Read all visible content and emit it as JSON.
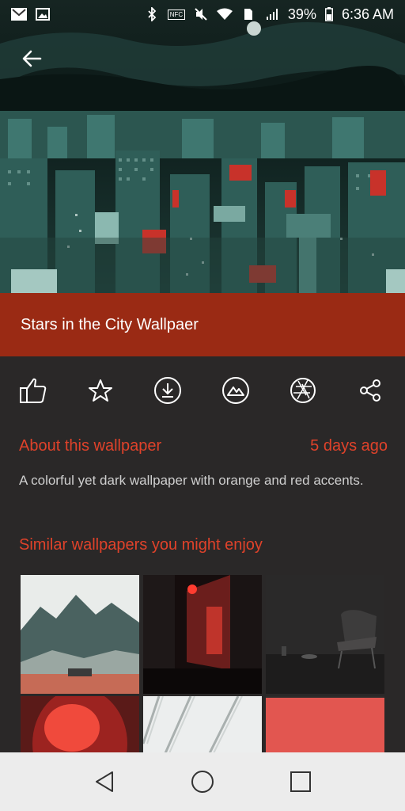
{
  "status_bar": {
    "battery_percent": "39%",
    "time": "6:36 AM",
    "nfc_label": "NFC",
    "left_icons": [
      "gmail-icon",
      "gallery-icon"
    ],
    "right_icons": [
      "bluetooth-icon",
      "nfc-icon",
      "mute-icon",
      "wifi-icon",
      "sim-icon",
      "signal-icon",
      "battery-icon"
    ]
  },
  "wallpaper": {
    "title": "Stars in the City Wallpaer",
    "accent_color": "#9a2a14",
    "highlight_color": "#e0422a"
  },
  "actions": [
    {
      "name": "like",
      "icon": "thumbs-up-icon"
    },
    {
      "name": "favorite",
      "icon": "star-icon"
    },
    {
      "name": "download",
      "icon": "download-icon"
    },
    {
      "name": "set-wallpaper",
      "icon": "landscape-icon"
    },
    {
      "name": "apply",
      "icon": "aperture-icon"
    },
    {
      "name": "share",
      "icon": "share-icon"
    }
  ],
  "about": {
    "heading": "About this wallpaper",
    "date": "5 days ago",
    "description": "A colorful yet dark wallpaper with orange and red accents."
  },
  "similar": {
    "heading": "Similar wallpapers you might enjoy",
    "tiles": [
      "mountain-landscape",
      "red-night-alley",
      "dark-chair-room",
      "red-abstract",
      "white-lines",
      "red-solid"
    ]
  },
  "nav": [
    "back-icon",
    "home-icon",
    "recents-icon"
  ]
}
